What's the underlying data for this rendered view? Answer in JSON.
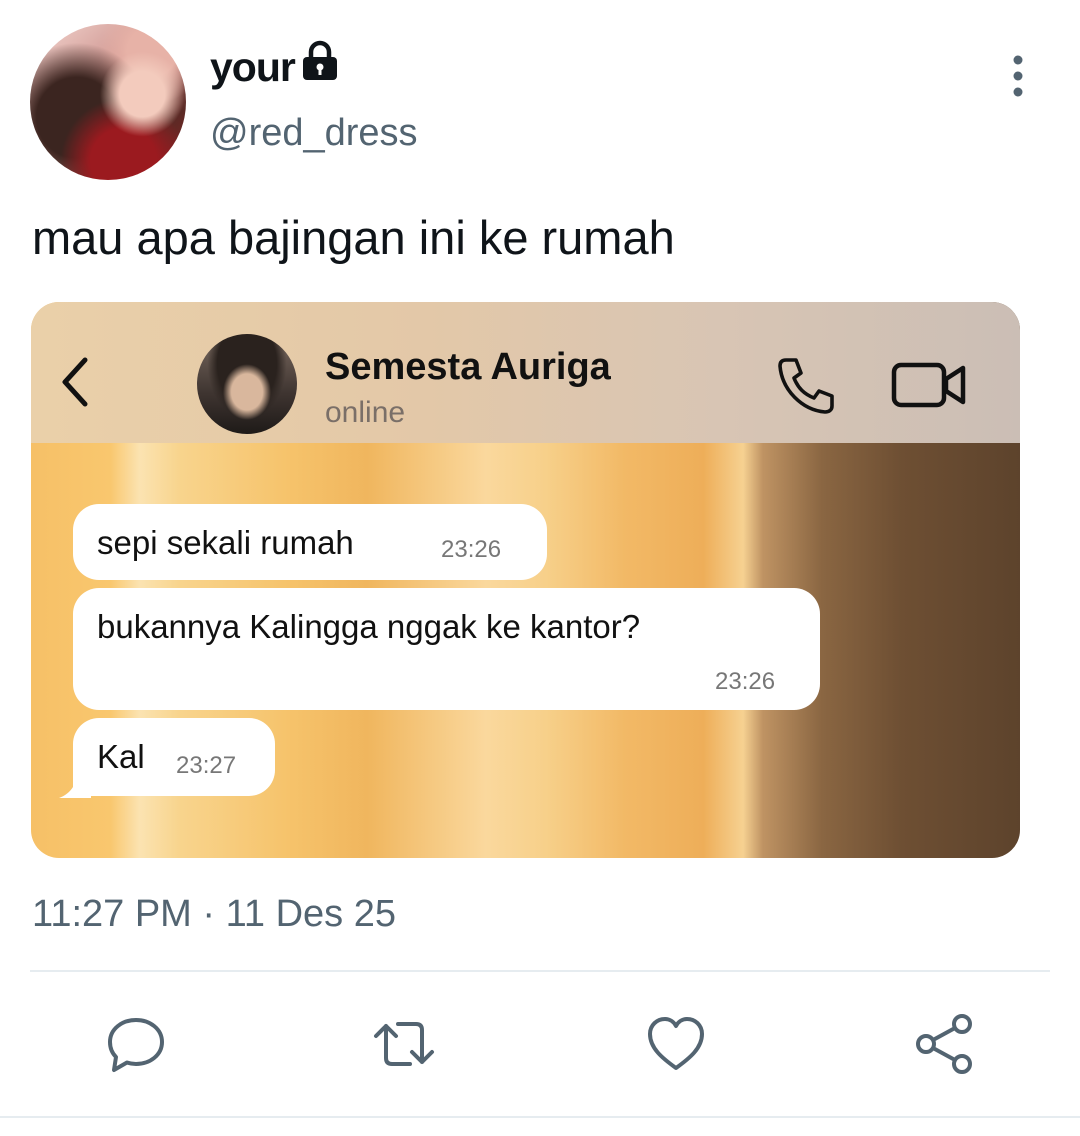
{
  "tweet": {
    "display_name": "your",
    "handle": "@red_dress",
    "text": "mau apa bajingan ini ke rumah",
    "timestamp": "11:27 PM · 11 Des 25"
  },
  "chat": {
    "contact_name": "Semesta Auriga",
    "status": "online",
    "messages": [
      {
        "text": "sepi sekali rumah",
        "time": "23:26"
      },
      {
        "text": "bukannya Kalingga nggak ke kantor?",
        "time": "23:26"
      },
      {
        "text": "Kal",
        "time": "23:27"
      }
    ]
  },
  "icons": {
    "lock": "lock-icon",
    "more": "more-vertical-icon",
    "back": "chevron-left-icon",
    "call": "phone-icon",
    "video": "video-camera-icon",
    "reply": "reply-icon",
    "retweet": "retweet-icon",
    "like": "heart-icon",
    "share": "share-icon"
  },
  "colors": {
    "text_primary": "#0f1419",
    "text_secondary": "#536471",
    "bubble": "#ffffff"
  }
}
